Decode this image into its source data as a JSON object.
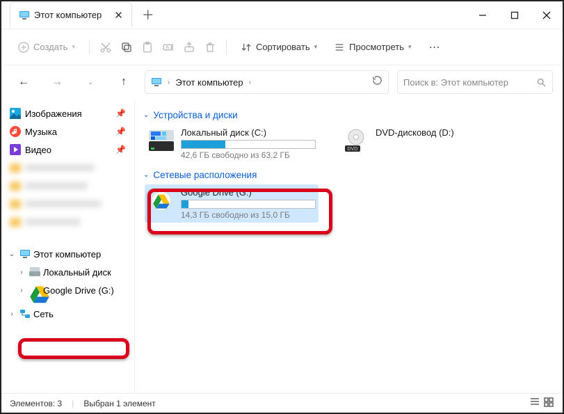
{
  "title": "Этот компьютер",
  "tab": {
    "label": "Этот компьютер"
  },
  "toolbar": {
    "create_label": "Создать",
    "sort_label": "Сортировать",
    "view_label": "Просмотреть"
  },
  "breadcrumb": {
    "current": "Этот компьютер"
  },
  "search": {
    "placeholder": "Поиск в: Этот компьютер"
  },
  "sidebar": {
    "pinned": [
      {
        "label": "Изображения"
      },
      {
        "label": "Музыка"
      },
      {
        "label": "Видео"
      }
    ],
    "blurred_count": 4,
    "tree": {
      "this_pc": "Этот компьютер",
      "local_disk": "Локальный диск",
      "gdrive": "Google Drive (G:)",
      "network": "Сеть"
    }
  },
  "content": {
    "devices_header": "Устройства и диски",
    "network_header": "Сетевые расположения",
    "local_disk": {
      "name": "Локальный диск (C:)",
      "free_text": "42,6 ГБ свободно из 63,2 ГБ",
      "used_pct": 33
    },
    "dvd": {
      "name": "DVD-дисковод (D:)",
      "badge": "DVD"
    },
    "gdrive": {
      "name": "Google Drive (G:)",
      "free_text": "14,3 ГБ свободно из 15,0 ГБ",
      "used_pct": 5,
      "selected": true
    }
  },
  "status": {
    "elements": "Элементов: 3",
    "selected": "Выбран 1 элемент"
  }
}
